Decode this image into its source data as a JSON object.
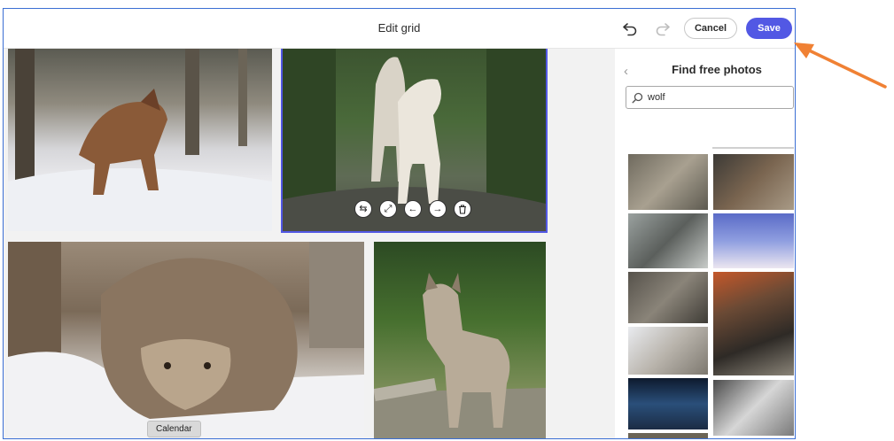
{
  "header": {
    "title": "Edit grid",
    "undo_icon": "undo-icon",
    "redo_icon": "redo-icon",
    "cancel_label": "Cancel",
    "save_label": "Save"
  },
  "colors": {
    "accent": "#5258e4",
    "annotation_arrow": "#f08134"
  },
  "grid": {
    "photos": [
      {
        "subject": "wolf in snowy forest"
      },
      {
        "subject": "two white wolves on rocks",
        "selected": true
      },
      {
        "subject": "wolf lying in snow close-up"
      },
      {
        "subject": "wolf standing in forest"
      }
    ],
    "photo_toolbar": [
      "swap-icon",
      "expand-icon",
      "move-left-icon",
      "move-right-icon",
      "trash-icon"
    ],
    "tooltip": "Calendar"
  },
  "panel": {
    "back_icon": "chevron-left-icon",
    "title": "Find free photos",
    "search_value": "wolf",
    "search_icon": "search-icon",
    "results_count": 15
  }
}
